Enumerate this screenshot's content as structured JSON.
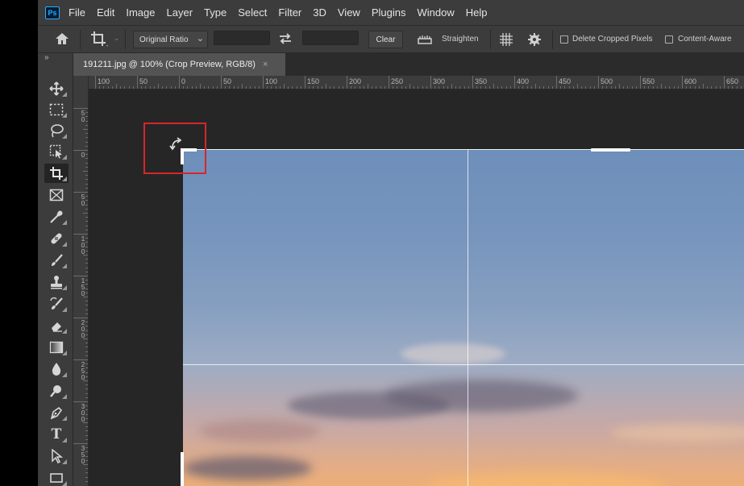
{
  "app": {
    "logo_text": "Ps",
    "menu": [
      "File",
      "Edit",
      "Image",
      "Layer",
      "Type",
      "Select",
      "Filter",
      "3D",
      "View",
      "Plugins",
      "Window",
      "Help"
    ]
  },
  "options_bar": {
    "ratio_select": "Original Ratio",
    "width_value": "",
    "height_value": "",
    "clear_label": "Clear",
    "straighten_label": "Straighten",
    "delete_cropped_label": "Delete Cropped Pixels",
    "delete_cropped_checked": false,
    "content_aware_label": "Content-Aware",
    "content_aware_checked": false
  },
  "tools_panel": {
    "collapse_label": "»",
    "tools": [
      "move",
      "rectangular-marquee",
      "lasso",
      "object-selection",
      "crop",
      "frame",
      "eyedropper",
      "spot-healing-brush",
      "brush",
      "clone-stamp",
      "history-brush",
      "eraser",
      "gradient",
      "blur",
      "dodge",
      "pen",
      "type",
      "path-selection",
      "rectangle"
    ],
    "active_tool": "crop",
    "type_tool_glyph": "T"
  },
  "document_tab": {
    "title": "191211.jpg @ 100% (Crop Preview, RGB/8)",
    "close_glyph": "×"
  },
  "rulers": {
    "horizontal_labels": [
      "100",
      "50",
      "0",
      "50",
      "100",
      "150",
      "200",
      "250",
      "300",
      "350",
      "400",
      "450",
      "500",
      "550",
      "600",
      "650"
    ],
    "vertical_labels": [
      "50",
      "0",
      "50",
      "100",
      "150",
      "200",
      "250",
      "300",
      "350"
    ]
  },
  "canvas": {
    "photo_subject": "sunset sky with clouds",
    "crop_mode": "Crop Preview",
    "highlight_color": "#d6262c"
  },
  "colors": {
    "panel": "#3c3c3c",
    "workspace": "#262626",
    "accent": "#31a8ff"
  }
}
